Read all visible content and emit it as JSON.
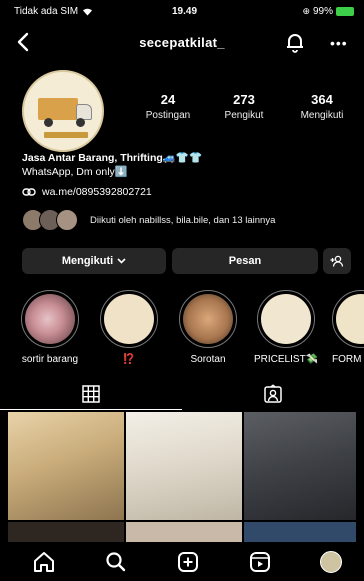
{
  "status_bar": {
    "carrier": "Tidak ada SIM",
    "time": "19.49",
    "battery": "99%"
  },
  "header": {
    "username": "secepatkilat_"
  },
  "profile": {
    "stats": [
      {
        "value": "24",
        "label": "Postingan"
      },
      {
        "value": "273",
        "label": "Pengikut"
      },
      {
        "value": "364",
        "label": "Mengikuti"
      }
    ],
    "bio_line1": "Jasa Antar Barang, Thrifting🚙👕👕",
    "bio_line2": "WhatsApp, Dm only⬇️",
    "link": "wa.me/0895392802721",
    "followed_by": "Diikuti oleh nabillss, bila.bile, dan 13 lainnya"
  },
  "actions": {
    "following_label": "Mengikuti",
    "message_label": "Pesan"
  },
  "highlights": [
    {
      "label": "sortir barang"
    },
    {
      "label": "⁉️"
    },
    {
      "label": "Sorotan"
    },
    {
      "label": "PRICELIST💸"
    },
    {
      "label": "FORM"
    }
  ],
  "icons": {
    "back": "back-arrow-icon",
    "notifications": "bell-icon",
    "more": "more-icon",
    "link": "link-icon",
    "add_user": "add-user-icon",
    "grid_tab": "grid-icon",
    "tagged_tab": "tagged-icon",
    "home": "home-icon",
    "search": "search-icon",
    "create": "create-icon",
    "reels": "reels-icon"
  },
  "colors": {
    "background": "#000000",
    "button": "#262626",
    "battery": "#3ecf4a"
  }
}
